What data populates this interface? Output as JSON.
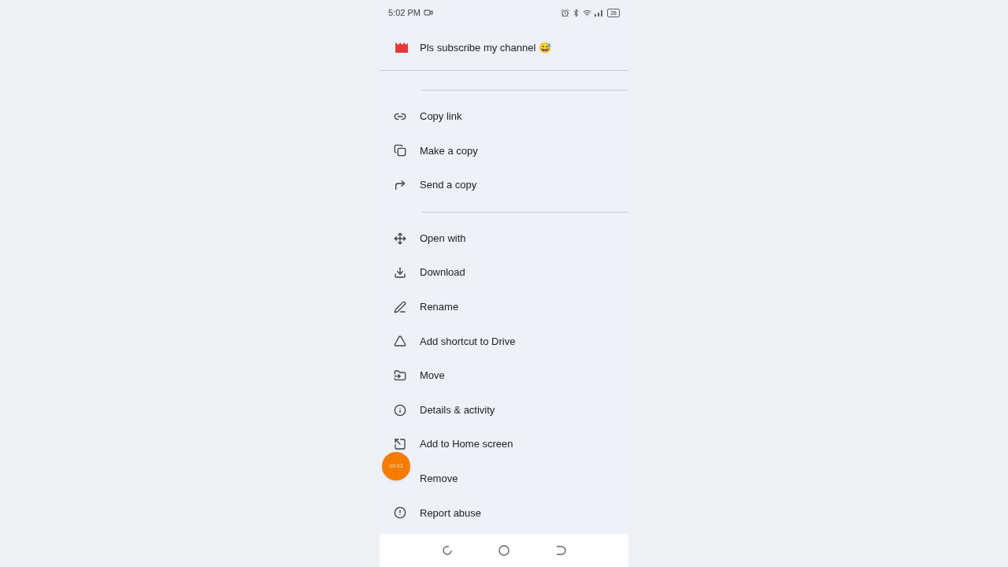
{
  "status_bar": {
    "time": "5:02 PM",
    "battery": "28"
  },
  "header": {
    "title": "Pls subscribe my channel 😅"
  },
  "menu_groups": [
    [
      {
        "kind": "link",
        "label": "Copy link"
      },
      {
        "kind": "copy",
        "label": "Make a copy"
      },
      {
        "kind": "send",
        "label": "Send a copy"
      }
    ],
    [
      {
        "kind": "open",
        "label": "Open with"
      },
      {
        "kind": "download",
        "label": "Download"
      },
      {
        "kind": "rename",
        "label": "Rename"
      },
      {
        "kind": "shortcut",
        "label": "Add shortcut to Drive"
      },
      {
        "kind": "move",
        "label": "Move"
      },
      {
        "kind": "info",
        "label": "Details & activity"
      },
      {
        "kind": "home",
        "label": "Add to Home screen"
      },
      {
        "kind": "none",
        "label": "Remove"
      },
      {
        "kind": "report",
        "label": "Report abuse"
      }
    ]
  ],
  "recording_badge": {
    "time": "00:43"
  }
}
